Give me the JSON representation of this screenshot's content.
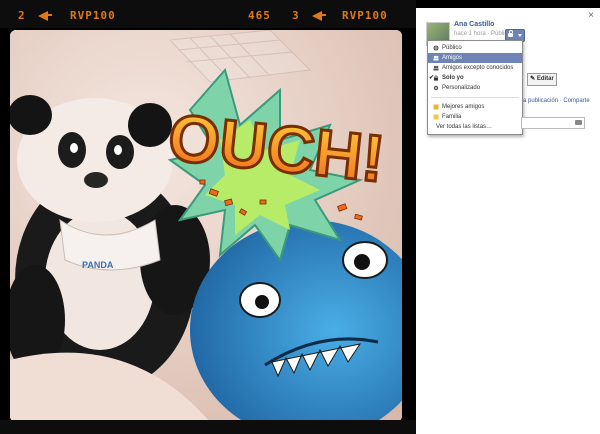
{
  "film": {
    "left_number": "2",
    "left_code": "RVP100",
    "frame_number": "465",
    "right_number": "3",
    "right_code": "RVP100"
  },
  "photo": {
    "toy_badge_text": "PANDA",
    "comic_text": "OUCH!"
  },
  "panel": {
    "owner_name": "Ana Castillo",
    "owner_meta": "hace 1 hora · Público",
    "privacy_menu": [
      {
        "label": "Público",
        "icon": "globe-icon"
      },
      {
        "label": "Amigos",
        "icon": "friends-icon",
        "selected": true
      },
      {
        "label": "Amigos excepto conocidos",
        "icon": "friends-icon"
      },
      {
        "label": "Solo yo",
        "icon": "lock-icon",
        "checked": true
      },
      {
        "label": "Personalizado",
        "icon": "gear-icon"
      }
    ],
    "lists": [
      {
        "label": "Mejores amigos",
        "icon": "star-icon"
      },
      {
        "label": "Familia",
        "icon": "family-icon"
      }
    ],
    "see_all_lists": "Ver todas las listas…",
    "edit_button": "Editar",
    "links": "a publicación · Comparte",
    "close": "×"
  },
  "colors": {
    "accent": "#6d84b4",
    "facebook_blue": "#3b5998",
    "film_orange": "#e07a16"
  }
}
